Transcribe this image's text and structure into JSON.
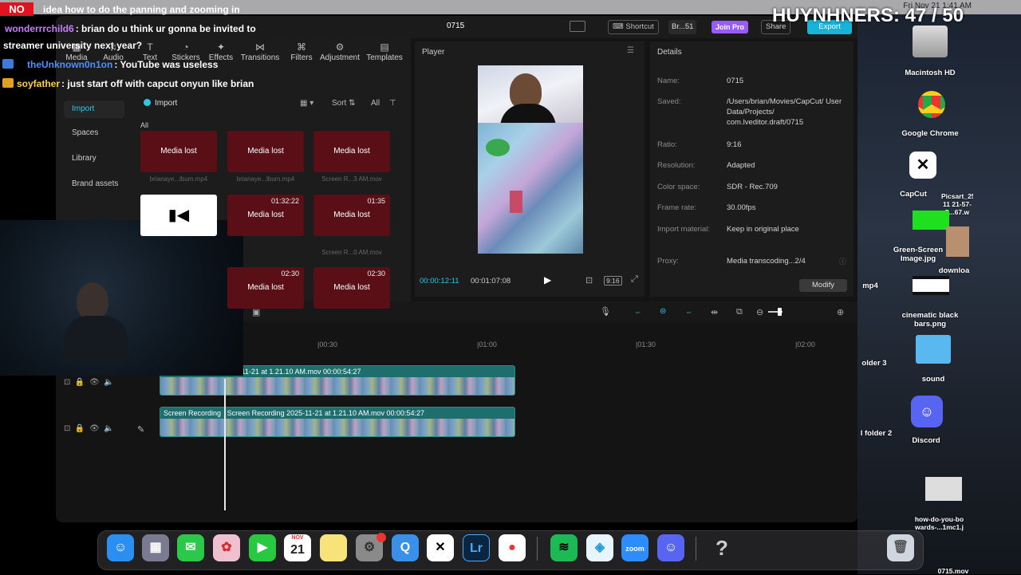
{
  "overlay": {
    "counter": "HUYNHNERS: 47 / 50",
    "badge": "NO"
  },
  "chat": [
    {
      "user": "",
      "msg": "idea how to do the panning and zooming in",
      "color": "#ffffff"
    },
    {
      "user": "wonderrrchild6",
      "msg": ": brian do u think ur gonna be invited to",
      "color": "#c77dff"
    },
    {
      "user": "",
      "msg": "streamer university next year?",
      "color": "#ffffff"
    },
    {
      "user": "theUnknown0n1on",
      "msg": ": YouTube was useless",
      "color": "#4f8fff"
    },
    {
      "user": "soyfather",
      "msg": ": just start off with capcut onyun like brian",
      "color": "#ffd24a"
    }
  ],
  "menubar": {
    "clock": "Fri Nov 21  1:41 AM"
  },
  "capcut": {
    "project_title": "0715",
    "shortcut_label": "Shortcut",
    "user_label": "Br...51",
    "pro_label": "Join Pro",
    "share_label": "Share",
    "export_label": "Export",
    "tools": [
      "Media",
      "Audio",
      "Text",
      "Stickers",
      "Effects",
      "Transitions",
      "Filters",
      "Adjustment",
      "Templates"
    ],
    "sidebar": [
      "Import",
      "Spaces",
      "Library",
      "Brand assets"
    ],
    "import_button": "Import",
    "sort_label": "Sort",
    "all_label": "All",
    "filter_all": "All",
    "tiles": [
      {
        "label": "Media lost",
        "caption": "brianaye...lbum.mp4",
        "duration": ""
      },
      {
        "label": "Media lost",
        "caption": "brianaye...lbum.mp4",
        "duration": ""
      },
      {
        "label": "Media lost",
        "caption": "Screen R...3 AM.mov",
        "duration": ""
      },
      {
        "label": "",
        "caption": "",
        "duration": ""
      },
      {
        "label": "Media lost",
        "caption": "",
        "duration": "01:32:22"
      },
      {
        "label": "Media lost",
        "caption": "Screen R...0 AM.mov",
        "duration": "01:35"
      },
      {
        "label": "Media lost",
        "caption": "",
        "duration": "02:30"
      },
      {
        "label": "Media lost",
        "caption": "",
        "duration": "02:30"
      }
    ],
    "player": {
      "title": "Player",
      "current": "00:00:12:11",
      "total": "00:01:07:08",
      "ratio": "9:16"
    },
    "details": {
      "title": "Details",
      "rows": [
        {
          "label": "Name:",
          "value": "0715"
        },
        {
          "label": "Saved:",
          "value": "/Users/brian/Movies/CapCut/ User Data/Projects/ com.lveditor.draft/0715"
        },
        {
          "label": "Ratio:",
          "value": "9:16"
        },
        {
          "label": "Resolution:",
          "value": "Adapted"
        },
        {
          "label": "Color space:",
          "value": "SDR - Rec.709"
        },
        {
          "label": "Frame rate:",
          "value": "30.00fps"
        },
        {
          "label": "Import material:",
          "value": "Keep in original place"
        },
        {
          "label": "Proxy:",
          "value": "Media transcoding...2/4"
        }
      ],
      "modify_label": "Modify"
    },
    "timeline": {
      "ruler": [
        "|00:30",
        "|01:00",
        "|01:30",
        "|02:00"
      ],
      "track1_label": "Screen Recording 2025-11-21 at 1.21.10 AM.mov  00:00:54:27",
      "track2_label_a": "Screen Recording",
      "track2_label_b": "Screen Recording 2025-11-21 at 1.21.10 AM.mov  00:00:54:27"
    }
  },
  "desktop": {
    "items": [
      {
        "name": "Macintosh HD"
      },
      {
        "name": "Google Chrome"
      },
      {
        "name": "CapCut"
      },
      {
        "name": "Picsart_25-11 21-57-5...67.w"
      },
      {
        "name": "Green-Screen Image.jpg"
      },
      {
        "name": "downloa"
      },
      {
        "name": "cinematic black bars.png"
      },
      {
        "name": "sound"
      },
      {
        "name": "Discord"
      },
      {
        "name": "how-do-you-bo wards-...1mc1.j"
      },
      {
        "name": "older 3"
      },
      {
        "name": "l folder 2"
      },
      {
        "name": "mp4"
      },
      {
        "name": "0715.mov"
      }
    ]
  },
  "dock": {
    "apps": [
      "Finder",
      "Launchpad",
      "Messages",
      "Photos",
      "FaceTime",
      "Calendar",
      "Notes",
      "System Settings",
      "QuickTime",
      "CapCut",
      "Lightroom",
      "Chrome",
      "Spotify",
      "Proton VPN",
      "Zoom",
      "Discord",
      "Help",
      "Trash"
    ],
    "calendar_month": "NOV",
    "calendar_day": "21",
    "lightroom_text": "Lr",
    "zoom_text": "zoom",
    "help_text": "?"
  }
}
